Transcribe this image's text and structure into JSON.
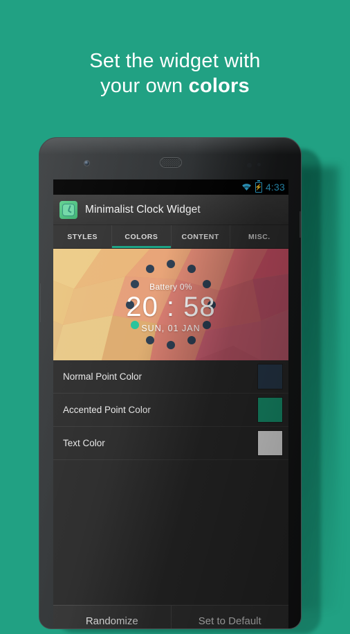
{
  "promo": {
    "line1": "Set the widget with",
    "line2_normal": "your own ",
    "line2_bold": "colors"
  },
  "theme": {
    "background": "#21a183",
    "accent": "#19a383",
    "holo_blue": "#33b5e5",
    "panel": "#2b2b2b",
    "actionbar": "#333333"
  },
  "status_bar": {
    "time": "4:33",
    "wifi_icon": "wifi-icon",
    "battery_icon": "battery-charging-icon"
  },
  "action_bar": {
    "app_icon": "clock-app-icon",
    "title": "Minimalist Clock Widget"
  },
  "tabs": [
    {
      "label": "STYLES",
      "active": false
    },
    {
      "label": "COLORS",
      "active": true
    },
    {
      "label": "CONTENT",
      "active": false
    },
    {
      "label": "MISC.",
      "active": false
    }
  ],
  "widget_preview": {
    "battery": "Battery 0%",
    "time": "20 : 58",
    "date": "SUN, 01 JAN",
    "normal_point_color": "#2b3e52",
    "accented_point_color": "#25c39a",
    "text_color": "#ffffff",
    "accent_dot_index": 8,
    "dot_count": 12
  },
  "settings": [
    {
      "label": "Normal Point Color",
      "swatch": "#2b3e52",
      "name": "normal-point-color"
    },
    {
      "label": "Accented Point Color",
      "swatch": "#1aa47c",
      "name": "accented-point-color"
    },
    {
      "label": "Text Color",
      "swatch": "#ffffff",
      "name": "text-color"
    }
  ],
  "bottom_bar": {
    "randomize": "Randomize",
    "set_to_default": "Set to Default"
  }
}
